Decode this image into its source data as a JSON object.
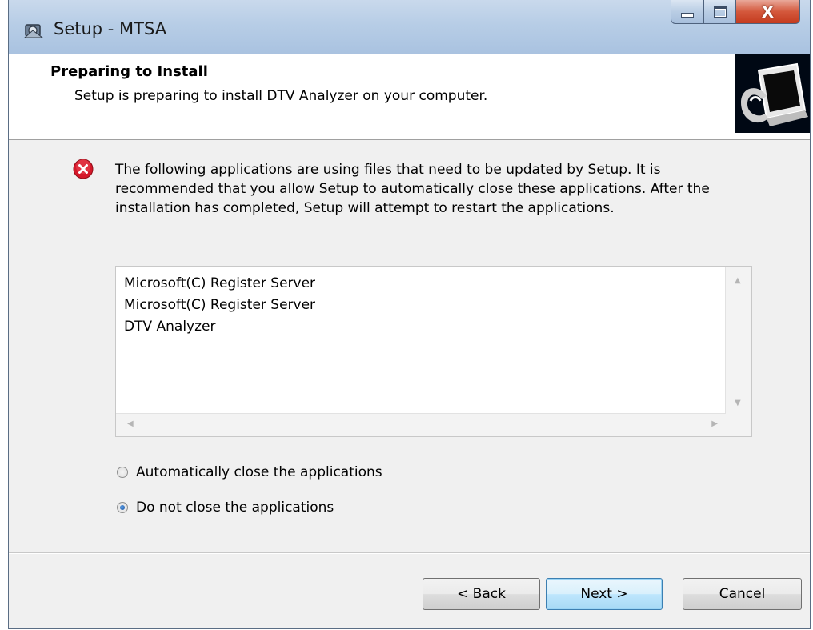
{
  "window": {
    "title": "Setup - MTSA",
    "app_icon": "installer-icon",
    "caption_buttons": [
      "minimize-icon",
      "maximize-icon",
      "close-icon"
    ],
    "close_glyph": "X"
  },
  "header": {
    "title": "Preparing to Install",
    "subtitle": "Setup is preparing to install DTV Analyzer on your computer.",
    "image": "computer-install-icon"
  },
  "message": {
    "icon": "error-icon",
    "text": "The following applications are using files that need to be updated by Setup. It is recommended that you allow Setup to automatically close these applications. After the installation has completed, Setup will attempt to restart the applications."
  },
  "applications": {
    "items": [
      "Microsoft(C) Register Server",
      "Microsoft(C) Register Server",
      "DTV Analyzer"
    ]
  },
  "options": [
    {
      "label": "Automatically close the applications",
      "selected": false
    },
    {
      "label": "Do not close the applications",
      "selected": true
    }
  ],
  "buttons": {
    "back": "< Back",
    "next": "Next >",
    "cancel": "Cancel"
  },
  "colors": {
    "titlebar": "#b7cde6",
    "close_button": "#c43b1e",
    "error_red": "#d5182a",
    "default_button_border": "#3c7fb1"
  }
}
